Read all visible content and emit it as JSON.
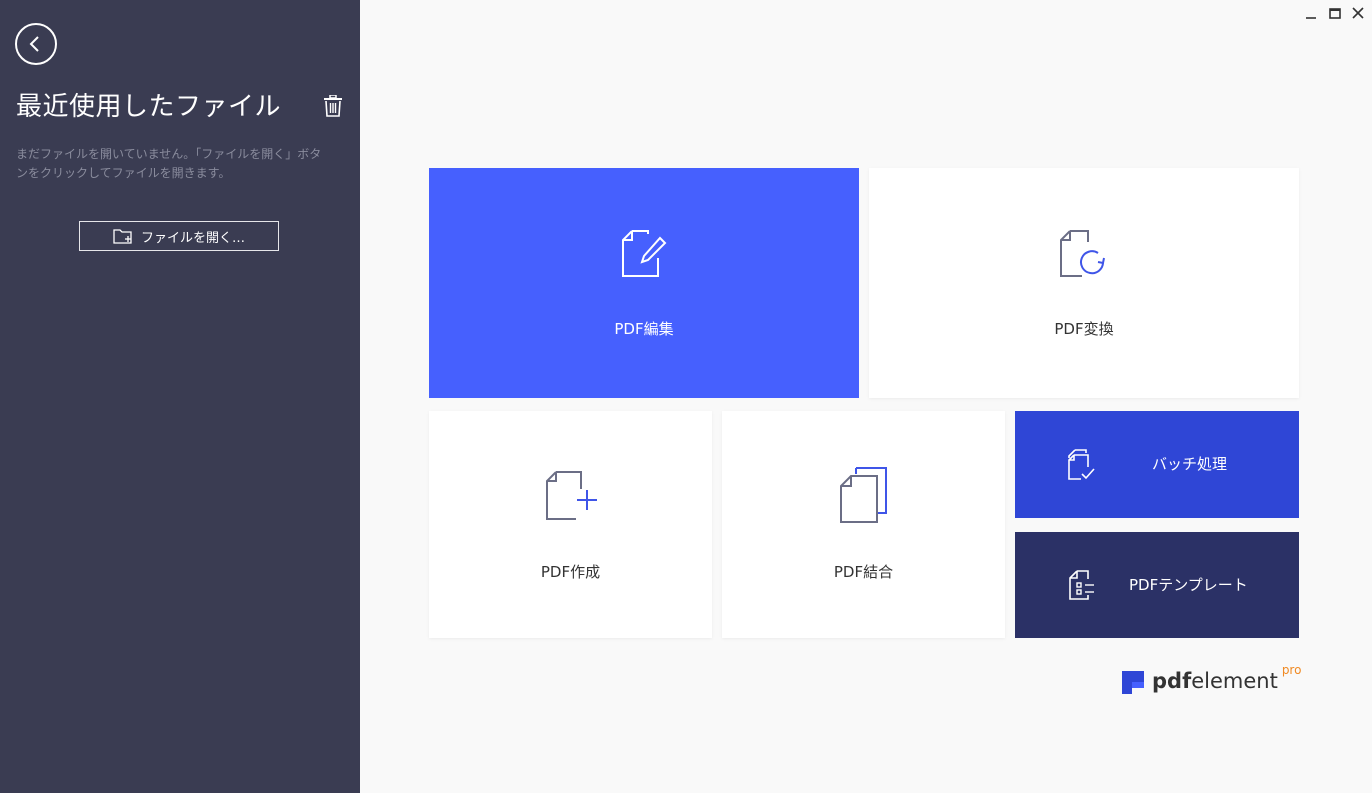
{
  "sidebar": {
    "title": "最近使用したファイル",
    "description": "まだファイルを開いていません。「ファイルを開く」ボタンをクリックしてファイルを開きます。",
    "open_button_label": "ファイルを開く…",
    "icons": [
      "back-arrow-icon",
      "trash-icon",
      "folder-add-icon"
    ]
  },
  "window_controls": [
    "minimize-icon",
    "maximize-icon",
    "close-icon"
  ],
  "tiles": {
    "edit": {
      "label": "PDF編集",
      "icon": "edit-document-icon"
    },
    "convert": {
      "label": "PDF変換",
      "icon": "convert-document-icon"
    },
    "create": {
      "label": "PDF作成",
      "icon": "create-document-icon"
    },
    "merge": {
      "label": "PDF結合",
      "icon": "merge-documents-icon"
    },
    "batch": {
      "label": "バッチ処理",
      "icon": "batch-process-icon"
    },
    "template": {
      "label": "PDFテンプレート",
      "icon": "template-icon"
    }
  },
  "brand": {
    "prefix": "pdf",
    "name": "element",
    "edition": "pro"
  },
  "colors": {
    "sidebar_bg": "#3a3c52",
    "edit_tile": "#4660fe",
    "batch_tile": "#2f46d6",
    "template_tile": "#2b3166",
    "brand_pro": "#f08a24"
  }
}
